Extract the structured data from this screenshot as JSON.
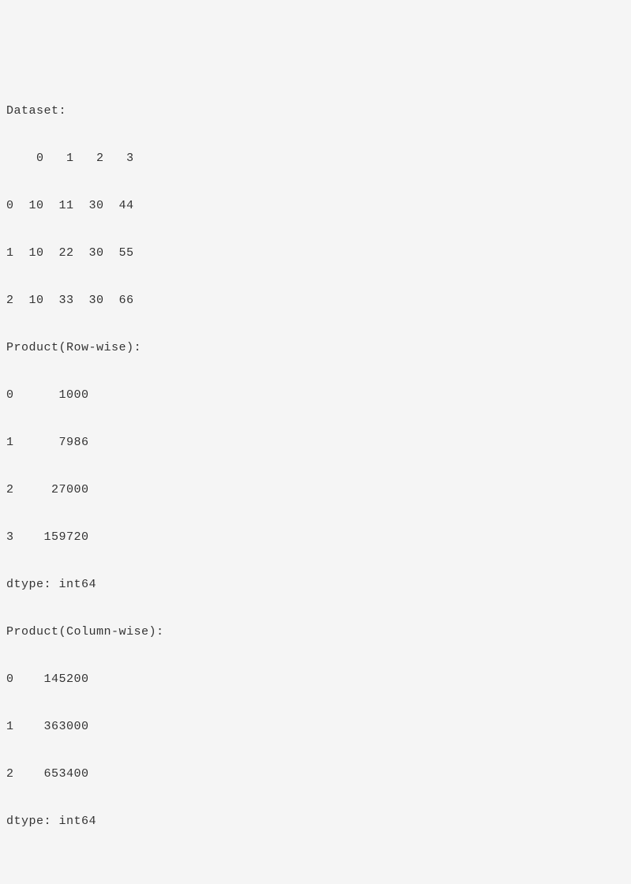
{
  "dataset": {
    "label": "Dataset:",
    "header": "    0   1   2   3",
    "rows": [
      "0  10  11  30  44",
      "1  10  22  30  55",
      "2  10  33  30  66"
    ]
  },
  "rowwise": {
    "label": "Product(Row-wise):",
    "rows": [
      "0      1000",
      "1      7986",
      "2     27000",
      "3    159720"
    ],
    "dtype": "dtype: int64"
  },
  "colwise": {
    "label": "Product(Column-wise):",
    "rows": [
      "0    145200",
      "1    363000",
      "2    653400"
    ],
    "dtype": "dtype: int64"
  }
}
